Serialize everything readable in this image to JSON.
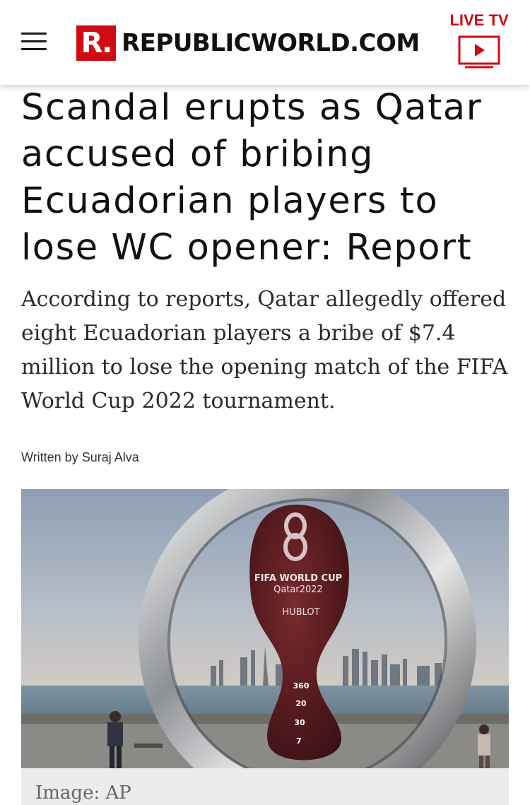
{
  "header": {
    "logo_mark": "R.",
    "logo_text": "REPUBLICWORLD.COM",
    "live_tv_label": "LIVE TV"
  },
  "article": {
    "headline_lines": [
      "Scandal erupts as Qatar",
      "accused of bribing",
      "Ecuadorian players to",
      "lose WC opener: Report"
    ],
    "summary": "According to reports, Qatar allegedly offered eight Ecuadorian players a bribe of $7.4 million to lose the opening match of the FIFA World Cup 2022 tournament.",
    "byline": "Written by Suraj Alva",
    "image": {
      "emblem_line1": "FIFA WORLD CUP",
      "emblem_line2": "Qatar2022",
      "brand": "HUBLOT",
      "count1": "360",
      "count2": "20",
      "count3": "30",
      "count4": "7",
      "caption": "Image: AP"
    }
  },
  "colors": {
    "brand_red": "#d10a11",
    "text": "#111111",
    "caption_bg": "#ececec"
  }
}
